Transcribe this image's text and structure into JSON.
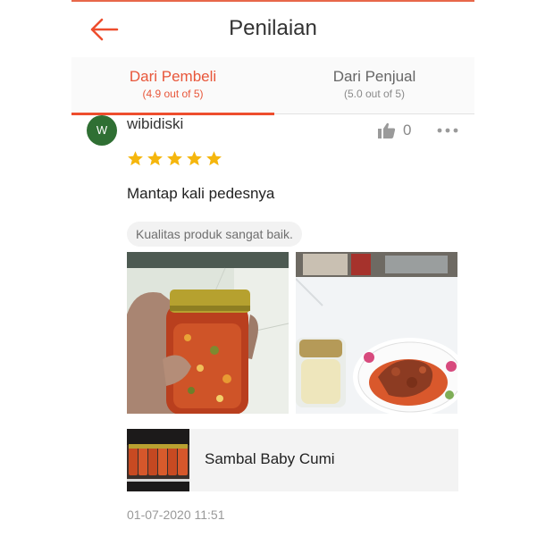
{
  "header": {
    "title": "Penilaian",
    "back_icon": "arrow-left-icon",
    "accent_color": "#ee4d2d"
  },
  "tabs": [
    {
      "label": "Dari Pembeli",
      "sub": "(4.9 out of 5)",
      "active": true
    },
    {
      "label": "Dari Penjual",
      "sub": "(5.0 out of 5)",
      "active": false
    }
  ],
  "review": {
    "avatar_initial": "W",
    "username": "wibidiski",
    "like_count": "0",
    "rating": 5,
    "star_color": "#f5b60d",
    "comment": "Mantap kali pedesnya",
    "tag": "Kualitas produk sangat baik.",
    "product": {
      "name": "Sambal Baby Cumi"
    },
    "timestamp": "01-07-2020 11:51",
    "icons": {
      "like": "thumbs-up-icon",
      "more": "more-options-icon",
      "star": "star-icon"
    }
  }
}
